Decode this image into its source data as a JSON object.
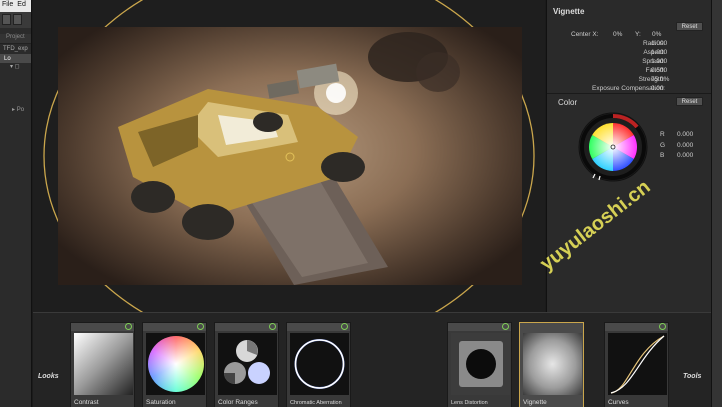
{
  "host": {
    "menu": [
      "File",
      "Ed"
    ],
    "project_tab": "Project",
    "project_file": "TFD_exp",
    "layer_label": "Lo",
    "tree_item": "Po"
  },
  "vignette": {
    "title": "Vignette",
    "reset_label": "Reset",
    "center_x_label": "Center X:",
    "center_x_value": "0%",
    "center_y_label": "Y:",
    "center_y_value": "0%",
    "params": [
      {
        "label": "Radius:",
        "value": "1.000"
      },
      {
        "label": "Aspect:",
        "value": "1.000"
      },
      {
        "label": "Spread:",
        "value": "1.000"
      },
      {
        "label": "Falloff:",
        "value": "0.500"
      },
      {
        "label": "Strength:",
        "value": "75.0%"
      },
      {
        "label": "Exposure Compensation:",
        "value": "0.00"
      }
    ]
  },
  "color": {
    "title": "Color",
    "reset_label": "Reset",
    "r_label": "R",
    "r_value": "0.000",
    "g_label": "G",
    "g_value": "0.000",
    "b_label": "B",
    "b_value": "0.000"
  },
  "bottom": {
    "looks_label": "Looks",
    "tools_label": "Tools",
    "tiles": [
      {
        "label": "Contrast",
        "icon": "contrast-gradient"
      },
      {
        "label": "Saturation",
        "icon": "saturation-wheel"
      },
      {
        "label": "Color Ranges",
        "icon": "color-ranges"
      },
      {
        "label": "Chromatic Aberration",
        "icon": "chromatic-ring"
      },
      {
        "label": "Lens Distortion",
        "icon": "lens-distortion"
      },
      {
        "label": "Vignette",
        "icon": "vignette",
        "active": true
      },
      {
        "label": "Curves",
        "icon": "curves"
      }
    ]
  },
  "watermark": "yuyulaoshi.cn",
  "colors": {
    "accent": "#caa64c",
    "power_on": "#7fcf56"
  }
}
